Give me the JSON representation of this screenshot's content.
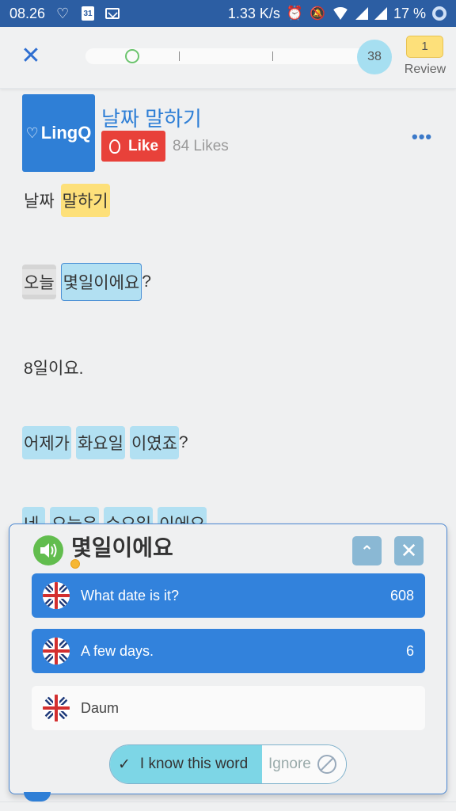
{
  "status_bar": {
    "time": "08.26",
    "speed": "1.33 K/s",
    "battery": "17 %",
    "calendar_day": "31",
    "icons": [
      "lingq-icon",
      "calendar-icon",
      "mail-icon",
      "alarm-icon",
      "bell-off-icon",
      "wifi-icon",
      "signal-icon",
      "signal-roaming-icon",
      "battery-icon"
    ]
  },
  "toolbar": {
    "close_glyph": "✕",
    "progress_fraction": 0.05,
    "lingq_count": "38",
    "review_count": "1",
    "review_label": "Review"
  },
  "lesson": {
    "logo_text": "LingQ",
    "title": "날짜 말하기",
    "like_label": "Like",
    "likes": "84 Likes",
    "more_glyph": "•••"
  },
  "text_lines": [
    [
      {
        "t": "날짜",
        "s": "known"
      },
      {
        "t": "말하기",
        "s": "yellow"
      }
    ],
    [
      {
        "t": "오늘",
        "s": "gray"
      },
      {
        "t": "몇일이에요",
        "s": "selected"
      },
      {
        "t": "?",
        "s": "punct"
      }
    ],
    [
      {
        "t": "8일이요.",
        "s": "known"
      }
    ],
    [
      {
        "t": "어제가",
        "s": "blue"
      },
      {
        "t": "화요일",
        "s": "blue"
      },
      {
        "t": "이였죠",
        "s": "blue"
      },
      {
        "t": "?",
        "s": "punct"
      }
    ],
    [
      {
        "t": "네,",
        "s": "blue"
      },
      {
        "t": "오늘은",
        "s": "blue"
      },
      {
        "t": "수요일",
        "s": "blue"
      },
      {
        "t": "이에요",
        "s": "blue"
      }
    ]
  ],
  "popup": {
    "term": "몇일이에요",
    "status_color": "#f6b733",
    "up_glyph": "⌃",
    "close_glyph": "✕",
    "meanings": [
      {
        "text": "What date is it?",
        "count": "608",
        "style": "primary"
      },
      {
        "text": "A few days.",
        "count": "6",
        "style": "primary"
      },
      {
        "text": "Daum",
        "count": "",
        "style": "secondary"
      }
    ],
    "know_label": "I know this word",
    "know_glyph": "✓",
    "ignore_label": "Ignore"
  },
  "colors": {
    "accent": "#2f7fd6",
    "status_bar": "#2c5ea3",
    "like": "#e8413a",
    "known_button": "#7dd6e6",
    "lingq_highlight": "#fde07a",
    "new_word": "#b2e0f2"
  }
}
